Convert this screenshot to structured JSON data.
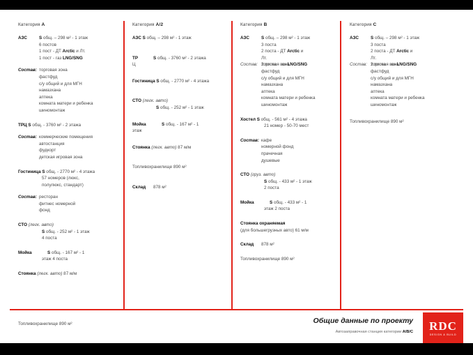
{
  "doc": {
    "bg": "#ffffff",
    "accent": "#e2231a"
  },
  "columns": [
    {
      "id": "a",
      "heading_prefix": "Категория ",
      "heading_bold": "A",
      "blocks": [
        {
          "key": "АЗС",
          "lines": [
            "S общ. – 298 м² - 1 этаж",
            "6 постов",
            "1 пост - ДТ Arctic и Лт.",
            "1 пост - газ LNG/SNG"
          ]
        },
        {
          "key": "Состав:",
          "italic": true,
          "lines": [
            "торговая зона",
            "фастфуд",
            "с/у общий и для МГН",
            "намазхана",
            "аптека",
            "комната матери и ребенка",
            "шиномонтаж"
          ]
        },
        {
          "key": "ТРЦ",
          "lines": [
            "S общ. - 3760 м² - 2 этажа"
          ]
        },
        {
          "key": "Состав:",
          "italic": true,
          "lines": [
            "коммерческие помещения",
            "автостанция",
            "фудкорт",
            "детская игровая зона"
          ]
        },
        {
          "key": "Гостиница",
          "lines": [
            "S общ. - 2770 м² - 4 этажа",
            "57 номеров (люкс,",
            "полулюкс, стандарт)"
          ]
        },
        {
          "key": "Состав:",
          "italic": true,
          "lines": [
            "ресторан",
            "фитнес  номерной",
            "фонд"
          ]
        },
        {
          "key": "СТО (легк. авто)",
          "lines": [
            "S общ. - 252 м² - 1 этаж",
            "4 поста"
          ]
        },
        {
          "key": "Мойка",
          "lines": [
            "S общ. - 167 м² - 1",
            "этаж  4 поста"
          ]
        },
        {
          "key": "Стоянка (легк. авто) 87 м/м",
          "lines": []
        }
      ],
      "below_divider": "Топливохранилище 890 м²"
    },
    {
      "id": "a2",
      "heading_prefix": "Категория ",
      "heading_bold": "A/2",
      "blocks": [
        {
          "key": "АЗС",
          "inline": "S общ. – 298 м² - 1 этаж"
        },
        {
          "key": "ТРЦ",
          "split": [
            "ТР",
            "Ц"
          ],
          "inline": "S общ. - 3760 м² - 2 этажа"
        },
        {
          "key": "Гостиница",
          "inline": "S общ. - 2770 м² - 4 этажа"
        },
        {
          "key": "СТО (легк. авто)",
          "lines": [
            "S общ. - 252 м² - 1 этаж"
          ]
        },
        {
          "key": "Мойка",
          "lines": [
            "S общ. - 167 м² - 1",
            "этаж"
          ]
        },
        {
          "key": "Стоянка (легк. авто) 87 м/м",
          "lines": []
        },
        {
          "key": "Топливохранилище 890 м²",
          "lines": []
        },
        {
          "key": "Склад",
          "inline2": "878 м²"
        }
      ]
    },
    {
      "id": "b",
      "heading_prefix": "Категория ",
      "heading_bold": "B",
      "blocks": [
        {
          "key": "АЗС",
          "lines": [
            "S общ. – 298 м² - 1 этаж",
            "3 поста",
            "2 поста - ДТ Arctic и",
            "Лт."
          ],
          "overlap": {
            "a": "Состав:",
            "b": "торговая зона",
            "c": "2 поста - газ LNG/SNG"
          }
        },
        {
          "key": "",
          "italic": true,
          "lines": [
            "фастфуд",
            "с/у общий и для МГН",
            "намазхана",
            "аптека",
            "комната матери и ребенка",
            "шиномонтаж"
          ]
        },
        {
          "key": "Хостел",
          "lines": [
            "S общ. - 561 м² - 4 этажа",
            "21 номер - 50-70 мест"
          ]
        },
        {
          "key": "Состав:",
          "italic": true,
          "lines": [
            "кафе",
            "номерной фонд",
            "прачечная",
            "душевые"
          ]
        },
        {
          "key": "СТО (груз. авто)",
          "lines": [
            "S общ. - 433 м² - 1 этаж",
            "2 поста"
          ]
        },
        {
          "key": "Мойка",
          "lines": [
            "S общ. - 433 м² - 1",
            "этаж  2 поста"
          ]
        },
        {
          "key": "Стоянка охраняемая",
          "lines2": [
            "(для большегрузных авто) 61 м/м"
          ]
        },
        {
          "key": "Склад",
          "inline2": "878 м²"
        },
        {
          "key": "Топливохранилище 890 м²",
          "lines": []
        }
      ]
    },
    {
      "id": "c",
      "heading_prefix": "Категория ",
      "heading_bold": "C",
      "blocks": [
        {
          "key": "АЗС",
          "lines": [
            "S общ. – 298 м² - 1 этаж",
            "3 поста",
            "2 поста - ДТ Arctic и",
            "Лт."
          ],
          "overlap": {
            "a": "Состав:",
            "b": "торговая зона",
            "c": "2 поста - газ LNG/SNG"
          }
        },
        {
          "key": "",
          "italic": true,
          "lines": [
            "фастфуд",
            "с/у общий и для МГН",
            "намазхана",
            "аптека",
            "комната матери и ребенка",
            "шиномонтаж"
          ]
        },
        {
          "key": "Топливохранилище  890 м²",
          "lines": []
        }
      ]
    }
  ],
  "footer": {
    "title": "Общие данные по проекту",
    "subtitle_pre": "Автозаправочная станция категории ",
    "subtitle_bold": "A/B/C",
    "logo_main": "RDC",
    "logo_sub": "DESIGN & BUILD"
  }
}
